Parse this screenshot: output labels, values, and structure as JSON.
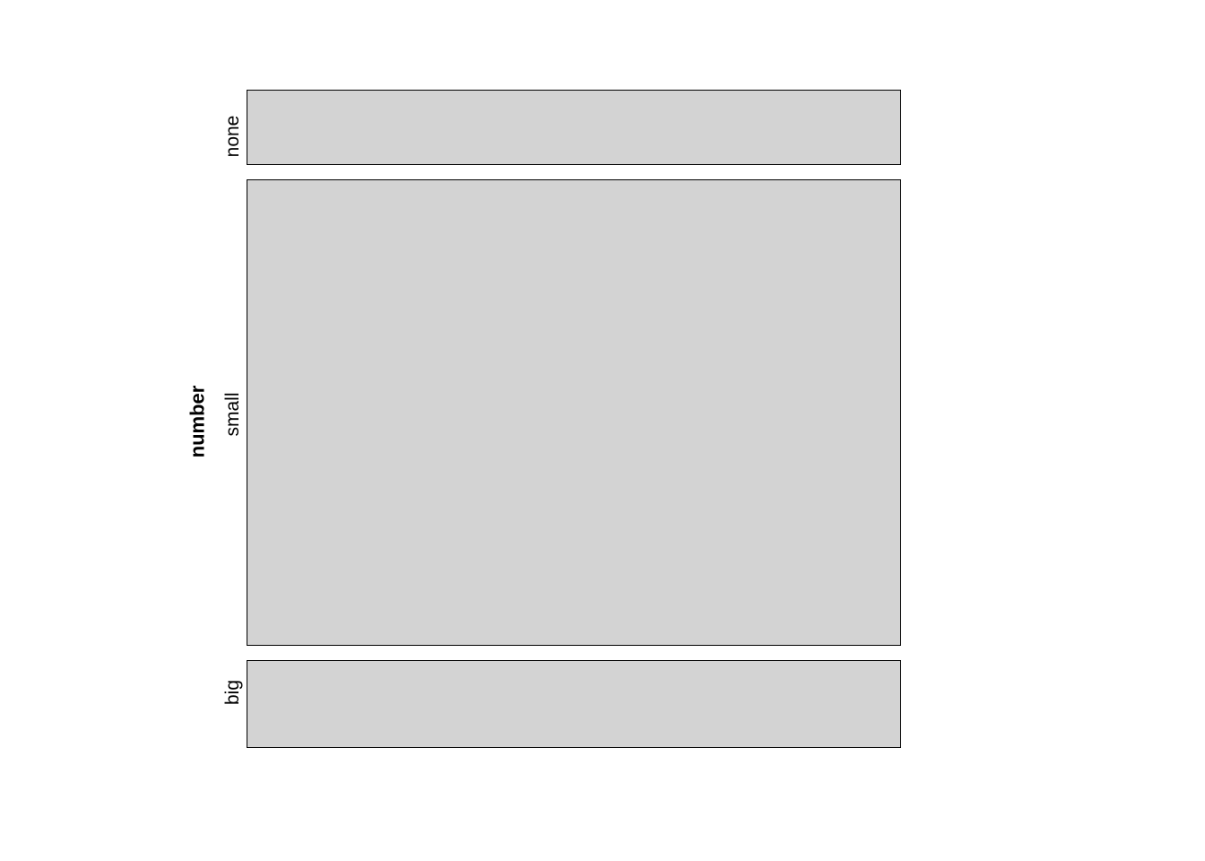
{
  "chart_data": {
    "type": "bar",
    "orientation": "horizontal",
    "ylabel": "number",
    "categories": [
      "none",
      "small",
      "big"
    ],
    "values": [
      0.12,
      0.74,
      0.14
    ],
    "bar_color": "#d3d3d3",
    "border_color": "#000000",
    "gap": 0.02
  },
  "labels": {
    "ylabel": "number",
    "cat_none": "none",
    "cat_small": "small",
    "cat_big": "big"
  }
}
